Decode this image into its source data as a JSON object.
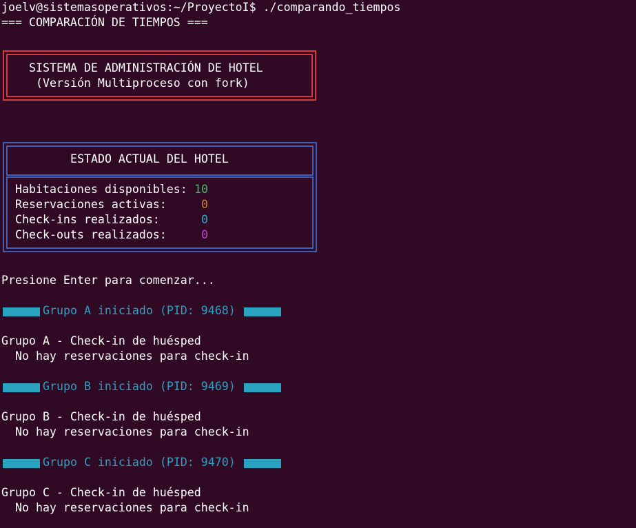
{
  "prompt": "joelv@sistemasoperativos:~/ProyectoI$ ./comparando_tiempos",
  "header": "=== COMPARACIÓN DE TIEMPOS ===",
  "title_box": {
    "line1": "SISTEMA DE ADMINISTRACIÓN DE HOTEL",
    "line2": "(Versión Multiproceso con fork)"
  },
  "status_box": {
    "heading": "ESTADO ACTUAL DEL HOTEL",
    "rows": [
      {
        "label": "Habitaciones disponibles:",
        "value": "10"
      },
      {
        "label": "Reservaciones activas:",
        "value": "0"
      },
      {
        "label": "Check-ins realizados:",
        "value": "0"
      },
      {
        "label": "Check-outs realizados:",
        "value": "0"
      }
    ]
  },
  "press_enter": "Presione Enter para comenzar...",
  "groups": [
    {
      "started": "Grupo A iniciado (PID: 9468)",
      "action": "Grupo A - Check-in de huésped",
      "message": "  No hay reservaciones para check-in"
    },
    {
      "started": "Grupo B iniciado (PID: 9469)",
      "action": "Grupo B - Check-in de huésped",
      "message": "  No hay reservaciones para check-in"
    },
    {
      "started": "Grupo C iniciado (PID: 9470)",
      "action": "Grupo C - Check-in de huésped",
      "message": "  No hay reservaciones para check-in"
    }
  ],
  "colors": {
    "background": "#300a24",
    "red_border": "#d23b3b",
    "blue_border": "#3f5fb4",
    "cyan": "#2aa3c0"
  }
}
